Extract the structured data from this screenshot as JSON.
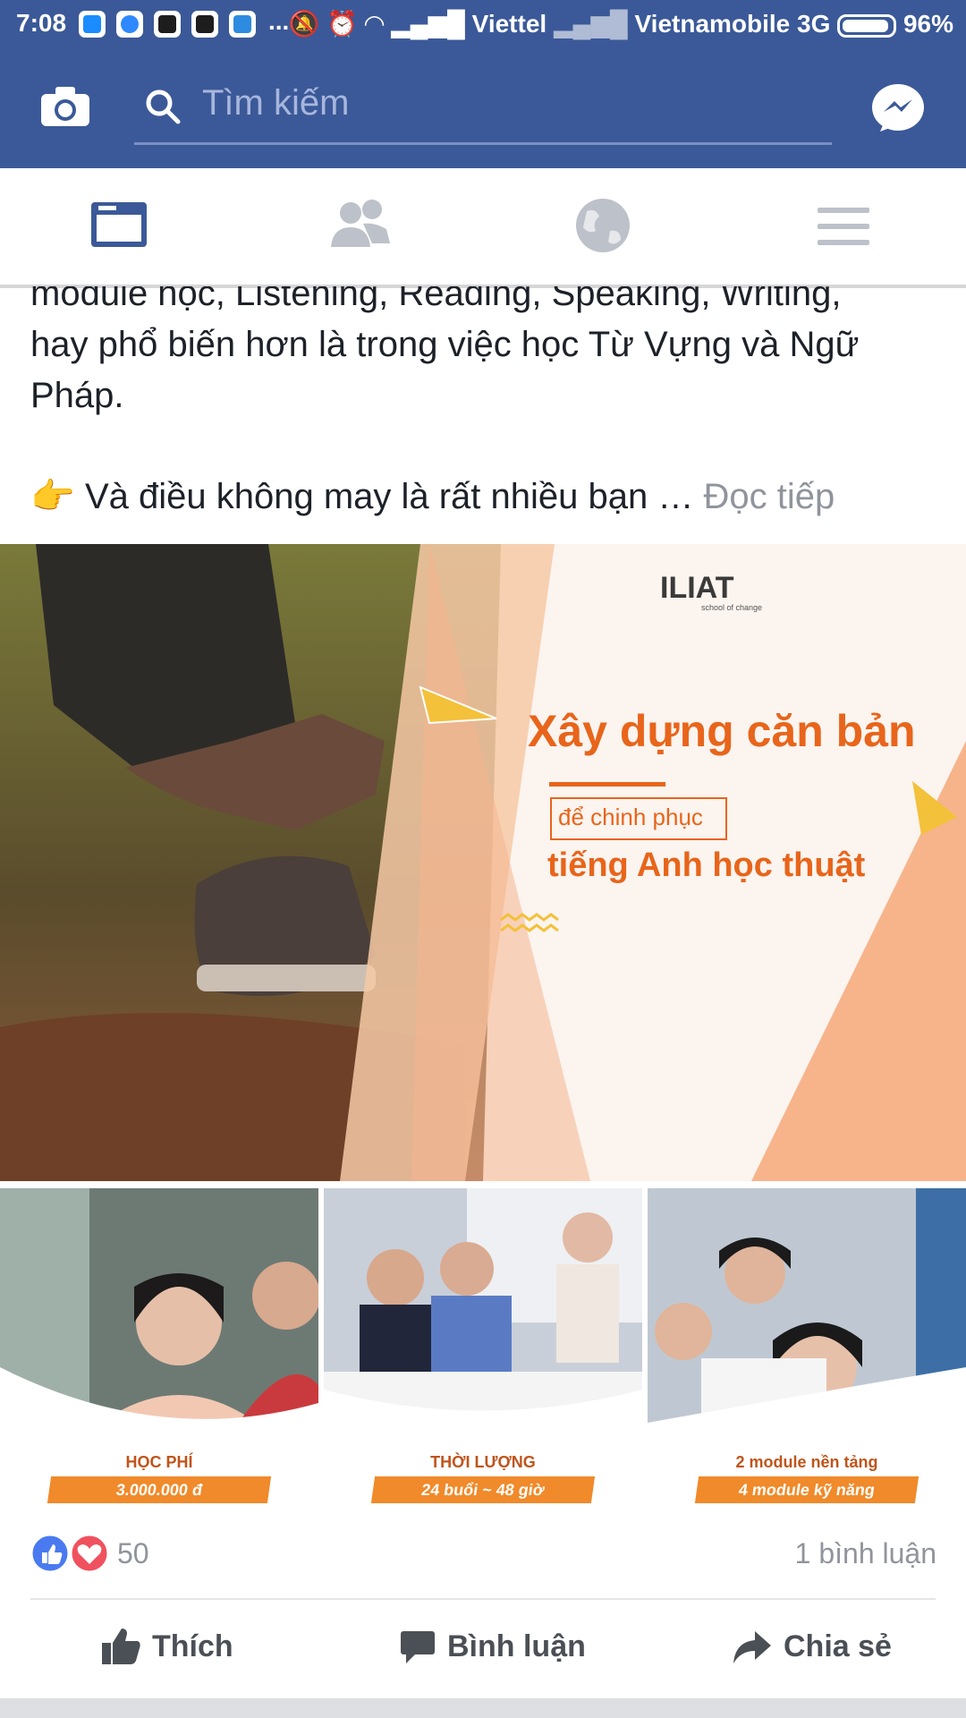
{
  "status_bar": {
    "time": "7:08",
    "notification_more": "...",
    "carrier1": "Viettel",
    "carrier2": "Vietnamobile 3G",
    "battery": "96%"
  },
  "header": {
    "search_placeholder": "Tìm kiếm"
  },
  "post": {
    "text_line1": "module học, Listening, Reading, Speaking, Writing,",
    "text_line2": "hay phổ biến hơn là trong việc học Từ Vựng và Ngữ",
    "text_line3": "Pháp.",
    "text_bullet": "Và điều không may là rất nhiều bạn … ",
    "read_more": "Đọc tiếp"
  },
  "banner": {
    "logo": "ILIAT",
    "logo_sub": "school of change",
    "headline": "Xây dựng căn bản",
    "sub_box": "để chinh phục",
    "subhead": "tiếng Anh học thuật"
  },
  "thumbs": [
    {
      "caption": "HỌC PHÍ",
      "value": "3.000.000 đ"
    },
    {
      "caption": "THỜI LƯỢNG",
      "value": "24 buổi ~ 48 giờ"
    },
    {
      "caption": "2 module nền tảng",
      "value": "4 module kỹ năng"
    }
  ],
  "reactions": {
    "count": "50",
    "comments": "1 bình luận"
  },
  "actions": {
    "like": "Thích",
    "comment": "Bình luận",
    "share": "Chia sẻ"
  },
  "colors": {
    "brand": "#3b5998",
    "accent_orange": "#e8651b",
    "like_blue": "#4a7af0",
    "love_red": "#f0515f"
  }
}
